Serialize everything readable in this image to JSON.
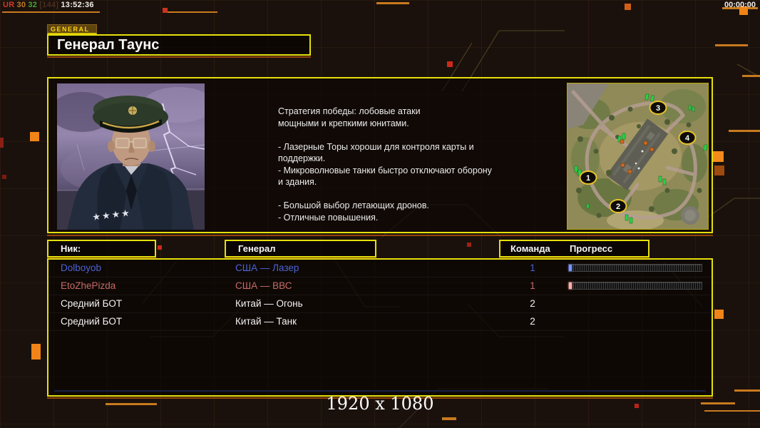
{
  "hud": {
    "debug": {
      "label": "UR",
      "value1": "30",
      "value2": "32",
      "bracket": "[144]",
      "clock": "13:52:36"
    },
    "timer": "00:00:00",
    "resolution": "1920 x 1080"
  },
  "header": {
    "tag": "GENERAL",
    "title": "Генерал Таунс"
  },
  "briefing": {
    "strategy_text": "Стратегия победы: лобовые атаки\nмощными и крепкими юнитами.\n\n- Лазерные Торы хороши для контроля карты и\nподдержки.\n- Микроволновые танки быстро отключают оборону\nи здания.\n\n- Большой выбор летающих дронов.\n- Отличные повышения."
  },
  "minimap": {
    "markers": [
      {
        "label": "1"
      },
      {
        "label": "2"
      },
      {
        "label": "3"
      },
      {
        "label": "4"
      }
    ]
  },
  "table": {
    "headers": {
      "nick": "Ник:",
      "general": "Генерал",
      "team": "Команда",
      "progress": "Прогресс"
    },
    "rows": [
      {
        "nick": "Dolboyob",
        "general": "США — Лазер",
        "team": "1",
        "color": "#4a63d6",
        "progress_pct": 2
      },
      {
        "nick": "EtoZhePizda",
        "general": "США — ВВС",
        "team": "1",
        "color": "#c66a66",
        "progress_pct": 2
      },
      {
        "nick": "Средний БОТ",
        "general": "Китай — Огонь",
        "team": "2",
        "color": "#f2f2f2"
      },
      {
        "nick": "Средний БОТ",
        "general": "Китай — Танк",
        "team": "2",
        "color": "#f2f2f2"
      }
    ]
  },
  "colors": {
    "accent_yellow": "#e6e00c",
    "accent_orange": "#c87a1e",
    "player_blue": "#4a63d6",
    "player_red": "#c66a66",
    "background": "#1a110c"
  }
}
